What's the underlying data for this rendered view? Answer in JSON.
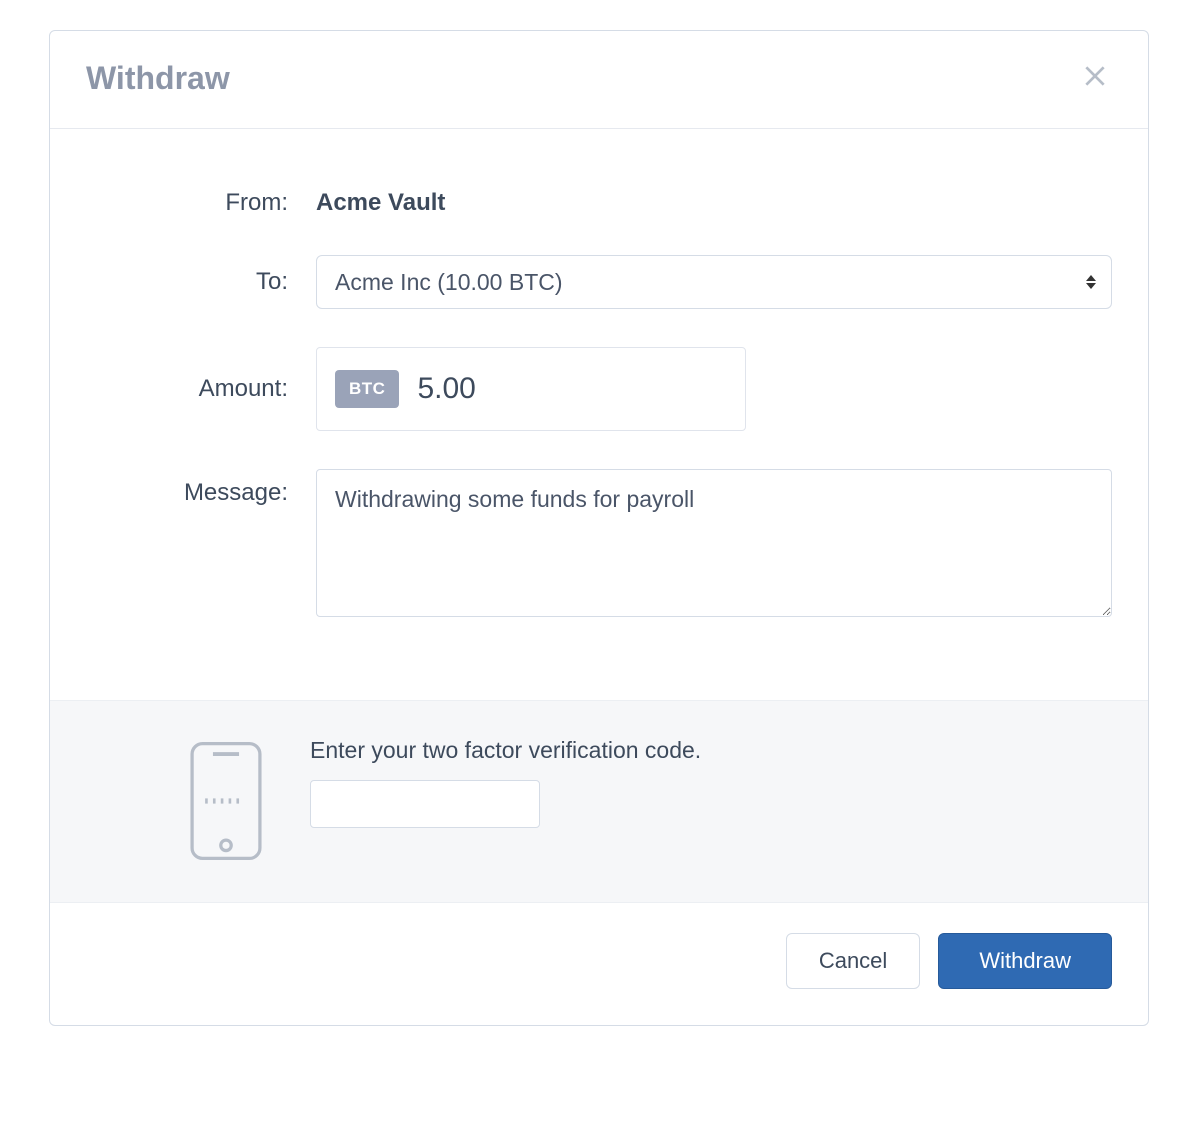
{
  "modal": {
    "title": "Withdraw"
  },
  "form": {
    "from_label": "From:",
    "from_value": "Acme Vault",
    "to_label": "To:",
    "to_selected": "Acme Inc (10.00 BTC)",
    "amount_label": "Amount:",
    "amount_currency": "BTC",
    "amount_value": "5.00",
    "message_label": "Message:",
    "message_value": "Withdrawing some funds for payroll"
  },
  "twofa": {
    "label": "Enter your two factor verification code.",
    "value": ""
  },
  "footer": {
    "cancel_label": "Cancel",
    "submit_label": "Withdraw"
  }
}
